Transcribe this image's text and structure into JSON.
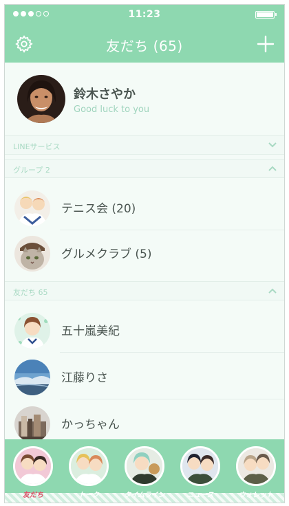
{
  "status_bar": {
    "time": "11:23"
  },
  "header": {
    "title": "友だち (65)"
  },
  "profile": {
    "name": "鈴木さやか",
    "status_message": "Good luck to you"
  },
  "sections": {
    "line_services": "LINEサービス",
    "groups": "グループ 2",
    "friends": "友だち 65"
  },
  "groups": [
    {
      "name": "テニス会 (20)",
      "icon": "group-avatar-tennis"
    },
    {
      "name": "グルメクラブ (5)",
      "icon": "group-avatar-cat"
    }
  ],
  "friends": [
    {
      "name": "五十嵐美紀",
      "icon": "friend-avatar-anime-girl"
    },
    {
      "name": "江藤りさ",
      "icon": "friend-avatar-sky"
    },
    {
      "name": "かっちゃん",
      "icon": "friend-avatar-books"
    }
  ],
  "tabs": [
    {
      "label": "友だち",
      "active": true
    },
    {
      "label": "トーク",
      "active": false
    },
    {
      "label": "タイムライン",
      "active": false
    },
    {
      "label": "ニュース",
      "active": false
    },
    {
      "label": "ウォレット",
      "active": false
    }
  ],
  "colors": {
    "accent": "#8ed8b0",
    "active_tab": "#e0526a",
    "status_text": "#9fd4bd"
  }
}
